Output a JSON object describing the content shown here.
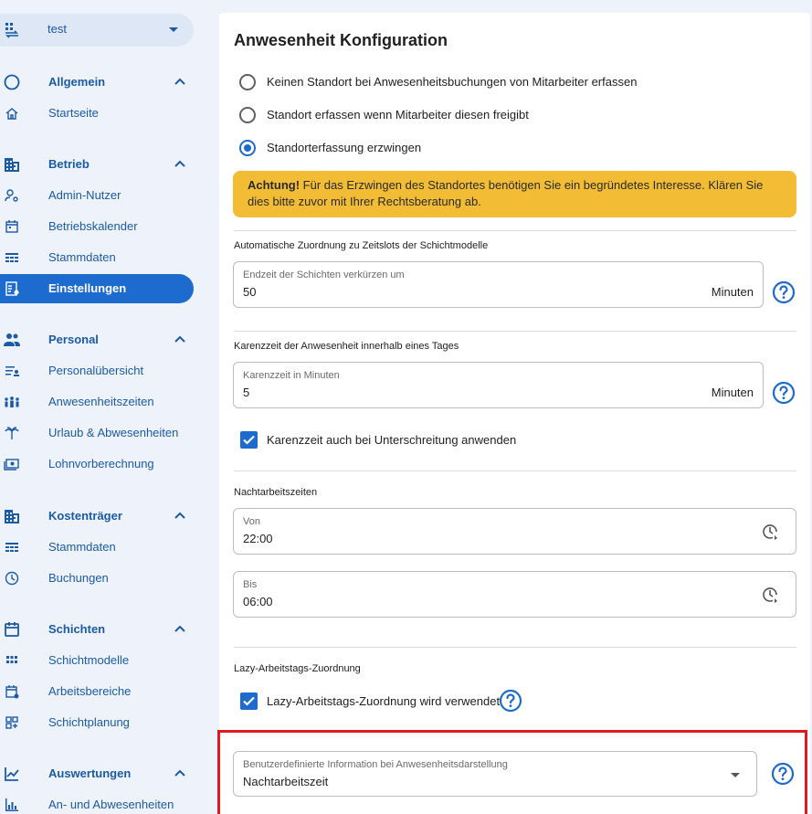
{
  "sidebar": {
    "tenant": {
      "label": "test",
      "icon": "building-switch-icon"
    },
    "items": [
      {
        "key": "allgemein",
        "label": "Allgemein",
        "icon": "circle-outline-icon",
        "group": true
      },
      {
        "key": "startseite",
        "label": "Startseite",
        "icon": "home-icon"
      },
      {
        "key": "betrieb",
        "label": "Betrieb",
        "icon": "building-icon",
        "group": true
      },
      {
        "key": "admin-nutzer",
        "label": "Admin-Nutzer",
        "icon": "user-gear-icon"
      },
      {
        "key": "betriebskalender",
        "label": "Betriebskalender",
        "icon": "calendar-icon"
      },
      {
        "key": "stammdaten-betrieb",
        "label": "Stammdaten",
        "icon": "data-table-icon"
      },
      {
        "key": "einstellungen",
        "label": "Einstellungen",
        "icon": "settings-doc-icon",
        "active": true
      },
      {
        "key": "personal",
        "label": "Personal",
        "icon": "people-icon",
        "group": true
      },
      {
        "key": "personaluebersicht",
        "label": "Personalübersicht",
        "icon": "list-person-icon"
      },
      {
        "key": "anwesenheitszeiten",
        "label": "Anwesenheitszeiten",
        "icon": "group-presence-icon"
      },
      {
        "key": "urlaub",
        "label": "Urlaub & Abwesenheiten",
        "icon": "palm-tree-icon"
      },
      {
        "key": "lohnvorberechnung",
        "label": "Lohnvorberechnung",
        "icon": "money-icon"
      },
      {
        "key": "kostentraeger",
        "label": "Kostenträger",
        "icon": "building-icon",
        "group": true
      },
      {
        "key": "stammdaten-kosten",
        "label": "Stammdaten",
        "icon": "data-table-icon"
      },
      {
        "key": "buchungen",
        "label": "Buchungen",
        "icon": "clock-icon"
      },
      {
        "key": "schichten",
        "label": "Schichten",
        "icon": "calendar-icon",
        "group": true
      },
      {
        "key": "schichtmodelle",
        "label": "Schichtmodelle",
        "icon": "grid-icon"
      },
      {
        "key": "arbeitsbereiche",
        "label": "Arbeitsbereiche",
        "icon": "calendar-edit-icon"
      },
      {
        "key": "schichtplanung",
        "label": "Schichtplanung",
        "icon": "grid-plus-icon"
      },
      {
        "key": "auswertungen",
        "label": "Auswertungen",
        "icon": "line-chart-icon",
        "group": true
      },
      {
        "key": "an-abwesenheiten",
        "label": "An- und Abwesenheiten",
        "icon": "bar-chart-icon"
      }
    ]
  },
  "main": {
    "title": "Anwesenheit Konfiguration",
    "radios": [
      {
        "label": "Keinen Standort bei Anwesenheitsbuchungen von Mitarbeiter erfassen",
        "checked": false
      },
      {
        "label": "Standort erfassen wenn Mitarbeiter diesen freigibt",
        "checked": false
      },
      {
        "label": "Standorterfassung erzwingen",
        "checked": true
      }
    ],
    "warning": {
      "bold": "Achtung!",
      "text": " Für das Erzwingen des Standortes benötigen Sie ein begründetes Interesse. Klären Sie dies bitte zuvor mit Ihrer Rechtsberatung ab."
    },
    "shift_section": {
      "heading": "Automatische Zuordnung zu Zeitslots der Schichtmodelle",
      "field_label": "Endzeit der Schichten verkürzen um",
      "value": "50",
      "suffix": "Minuten"
    },
    "grace_section": {
      "heading": "Karenzzeit der Anwesenheit innerhalb eines Tages",
      "field_label": "Karenzzeit in Minuten",
      "value": "5",
      "suffix": "Minuten",
      "checkbox_label": "Karenzzeit auch bei Unterschreitung anwenden",
      "checkbox_checked": true
    },
    "night_section": {
      "heading": "Nachtarbeitszeiten",
      "from_label": "Von",
      "from_value": "22:00",
      "to_label": "Bis",
      "to_value": "06:00"
    },
    "lazy_section": {
      "heading": "Lazy-Arbeitstags-Zuordnung",
      "checkbox_label": "Lazy-Arbeitstags-Zuordnung wird verwendet",
      "checkbox_checked": true
    },
    "custom_info": {
      "field_label": "Benutzerdefinierte Information bei Anwesenheitsdarstellung",
      "value": "Nachtarbeitszeit"
    }
  },
  "colors": {
    "primary": "#1e6bd0",
    "warning": "#f2bd35",
    "highlight": "#e0191f"
  }
}
